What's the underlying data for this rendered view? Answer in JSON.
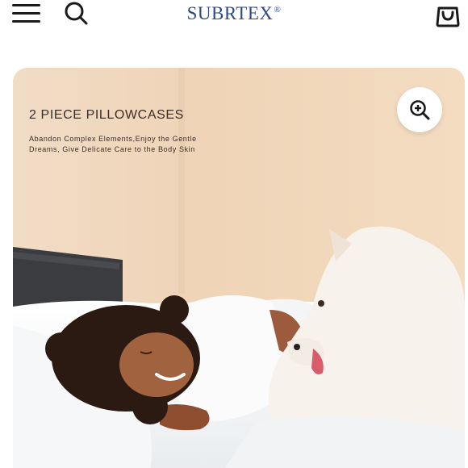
{
  "header": {
    "brand": "SUBRTEX",
    "brand_mark": "®",
    "menu_icon": "hamburger-menu-icon",
    "search_icon": "search-icon",
    "cart_icon": "shopping-bag-icon",
    "brand_color": "#2d4a84"
  },
  "hero": {
    "title": "2 PIECE PILLOWCASES",
    "subtitle_line1": "Abandon Complex Elements,Enjoy the Gentle",
    "subtitle_line2": "Dreams, Give Delicate Care to the Body Skin",
    "zoom_icon": "zoom-in-icon",
    "image_description_icon": "lifestyle-photo"
  }
}
